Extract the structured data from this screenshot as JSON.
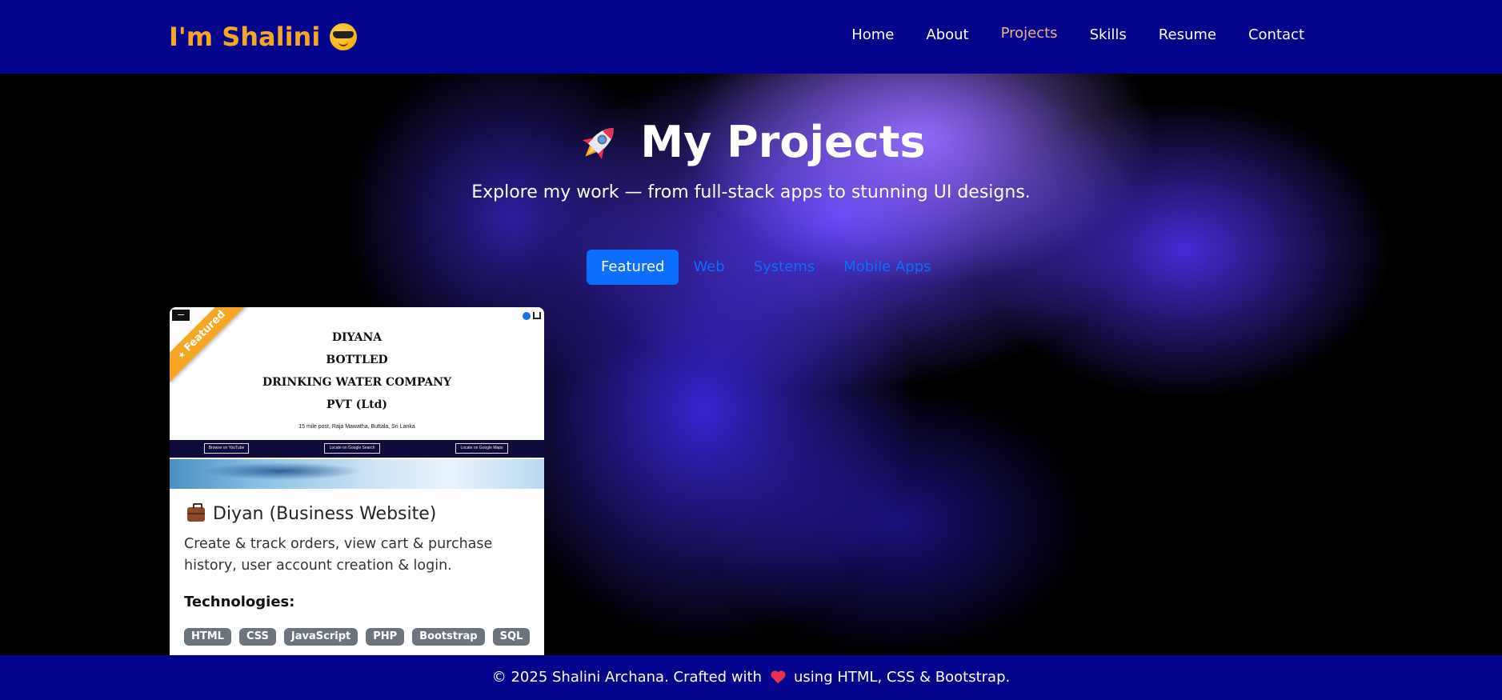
{
  "nav": {
    "brand": "I'm Shalini",
    "brand_icon": "sunglasses-emoji-icon",
    "links": [
      "Home",
      "About",
      "Projects",
      "Skills",
      "Resume",
      "Contact"
    ],
    "active": "Projects",
    "active_color": "#e8b38a",
    "brand_color": "#f5a623",
    "background": "#03038c"
  },
  "hero": {
    "title": "My Projects",
    "title_icon": "rocket-icon",
    "subtitle": "Explore my work — from full-stack apps to stunning UI designs."
  },
  "tabs": {
    "items": [
      "Featured",
      "Web",
      "Systems",
      "Mobile Apps"
    ],
    "active": "Featured",
    "accent": "#0d6efd"
  },
  "project": {
    "ribbon": "Featured",
    "screenshot": {
      "lines": [
        "DIYANA",
        "BOTTLED",
        "DRINKING WATER COMPANY",
        "PVT (Ltd)"
      ],
      "address": "15 mile post, Raja Mawatha, Buttala, Sri Lanka",
      "buttons": [
        "Browse on YouTube",
        "Locate on Google Search",
        "Locate on Google Maps"
      ]
    },
    "title": "Diyan (Business Website)",
    "title_icon": "briefcase-icon",
    "description": "Create & track orders, view cart & purchase history, user account creation & login.",
    "tech_label": "Technologies:",
    "technologies": [
      "HTML",
      "CSS",
      "JavaScript",
      "PHP",
      "Bootstrap",
      "SQL"
    ]
  },
  "footer": {
    "text_before": "© 2025 Shalini Archana. Crafted with",
    "icon": "heart-icon",
    "text_after": "using HTML, CSS & Bootstrap."
  }
}
